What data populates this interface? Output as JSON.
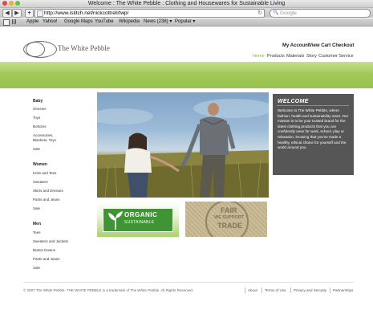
{
  "browser": {
    "window_title": "Welcome : The White Pebble : Clothing and Housewares for Sustainable Living",
    "url": "http://www.istitch.net/nickcottrell/twp/",
    "back_glyph": "◀",
    "forward_glyph": "▶",
    "add_glyph": "+",
    "reload_glyph": "↻",
    "search_placeholder": "Google",
    "bookmarks": [
      "Apple",
      "Yahoo!",
      "Google Maps",
      "YouTube",
      "Wikipedia",
      "News (238) ▾",
      "Popular ▾"
    ]
  },
  "header": {
    "logo_text": "The White Pebble",
    "account_links": [
      "My Account",
      "View Cart",
      "Checkout"
    ],
    "nav": [
      "Home",
      "Products",
      "Materials",
      "Story",
      "Customer Service"
    ],
    "active_nav": "Home"
  },
  "sidebar": {
    "groups": [
      {
        "heading": "Baby",
        "items": [
          "Onesies",
          "Toys",
          "Bottoms",
          "Accessories,",
          "Blankets, Toys",
          "Sale"
        ]
      },
      {
        "heading": "Women",
        "items": [
          "Knits and Tees",
          "Sweaters",
          "Skirts and Dresses",
          "Pants and Jeans",
          "Sale"
        ]
      },
      {
        "heading": "Men",
        "items": [
          "Tees",
          "Sweaters and Jackets",
          "Button Downs",
          "Pants and Jeans",
          "Sale"
        ]
      }
    ]
  },
  "welcome": {
    "title": "WELCOME",
    "text": "Welcome to The White Pebble, where fashion, health and sustainability meet. Our mission is to be your trusted brand for the latest clothing products that you can confidently wear for work, school, play or relaxation, knowing that you've made a healthy, ethical choice for yourself and the world around you."
  },
  "badges": {
    "organic_title": "ORGANIC",
    "organic_sub": "SUSTAINABLE",
    "fair_t1": "FAIR",
    "fair_t2": "WE SUPPORT",
    "fair_t3": "TRADE"
  },
  "footer": {
    "copyright": "© 2007 The White Pebble. THE WHITE PEBBLE is a trademark of The White Pebble. All Rights Reserved.",
    "links": [
      "About",
      "Terms of Use",
      "Privacy and Security",
      "Partnerships"
    ]
  },
  "colors": {
    "accent_green": "#98c24e",
    "welcome_bg": "#565656",
    "organic_green": "#3f9434"
  }
}
